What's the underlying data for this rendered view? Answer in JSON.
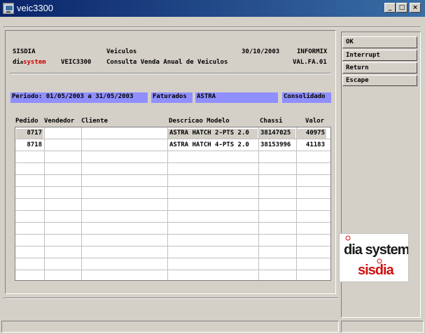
{
  "window": {
    "title": "veic3300",
    "min_glyph": "_",
    "max_glyph": "□",
    "close_glyph": "×"
  },
  "header": {
    "system": "SISDIA",
    "module": "Veiculos",
    "date": "30/10/2003",
    "db": "INFORMIX",
    "brand_prefix": "di",
    "brand_dots": "a",
    "brand_system": "system",
    "program": "VEIC3300",
    "description": "Consulta Venda Anual de Veiculos",
    "code": "VAL.FA.01"
  },
  "filters": {
    "periodo": "Periodo: 01/05/2003 a 31/05/2003",
    "faturados": "Faturados",
    "modelo": "ASTRA",
    "consolidado": "Consolidado"
  },
  "actions": {
    "ok": "OK",
    "interrupt": "Interrupt",
    "return": "Return",
    "escape": "Escape"
  },
  "table": {
    "columns": [
      "Pedido",
      "Vendedor",
      "Cliente",
      "Descricao Modelo",
      "Chassi",
      "Valor"
    ],
    "rows": [
      {
        "pedido": "8717",
        "vendedor": "",
        "cliente": "",
        "modelo": "ASTRA HATCH 2-PTS 2.0",
        "chassi": "38147025",
        "valor": "40975"
      },
      {
        "pedido": "8718",
        "vendedor": "",
        "cliente": "",
        "modelo": "ASTRA HATCH 4-PTS 2.0",
        "chassi": "38153996",
        "valor": "41183"
      }
    ]
  },
  "logo": {
    "line1": "dia system",
    "line2": "sisdia",
    "colors": {
      "dark": "#1a1a1a",
      "red": "#d01010"
    }
  },
  "colors": {
    "filter_bar": "#8f8fff",
    "title_start": "#0a246a",
    "title_end": "#3a6ea5"
  }
}
